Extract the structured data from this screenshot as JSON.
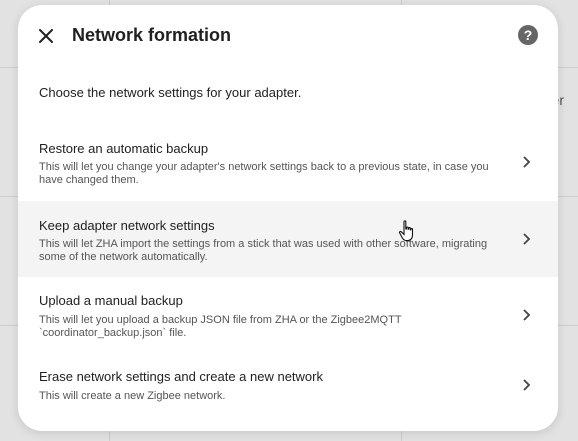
{
  "dialog": {
    "title": "Network formation",
    "intro": "Choose the network settings for your adapter.",
    "help": "?",
    "options": [
      {
        "title": "Restore an automatic backup",
        "description": "This will let you change your adapter's network settings back to a previous state, in case you have changed them."
      },
      {
        "title": "Keep adapter network settings",
        "description": "This will let ZHA import the settings from a stick that was used with other software, migrating some of the network automatically."
      },
      {
        "title": "Upload a manual backup",
        "description": "This will let you upload a backup JSON file from ZHA or the Zigbee2MQTT `coordinator_backup.json` file."
      },
      {
        "title": "Erase network settings and create a new network",
        "description": "This will create a new Zigbee network."
      }
    ]
  },
  "background": {
    "partial_text": "er"
  },
  "icons": {
    "close": "close-icon",
    "help": "help-icon",
    "chevron": "chevron-right-icon",
    "cursor": "hand-pointer-icon"
  },
  "colors": {
    "surface": "#ffffff",
    "hover": "#f4f4f4",
    "text": "#212121",
    "secondary": "#555555"
  }
}
